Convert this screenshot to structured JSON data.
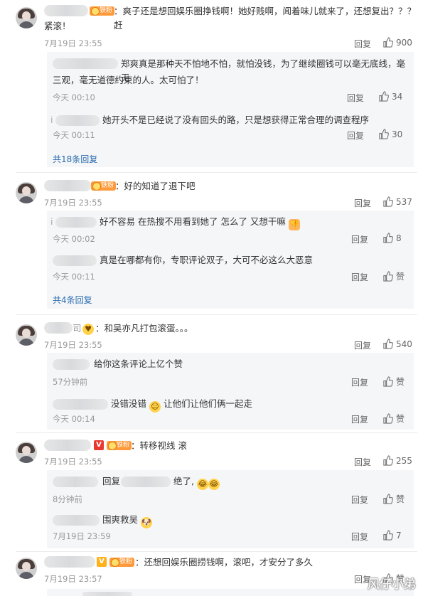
{
  "badges": {
    "fan": "铁粉",
    "vip": "V"
  },
  "comments": [
    {
      "text_line1": "：爽子还是想回娱乐圈挣钱啊！她好贱啊，闻着味儿就来了，还想复出？？？赶",
      "text_line2": "紧滚！",
      "time": "7月19日 23:55",
      "reply": "回复",
      "likes": "900",
      "subs": [
        {
          "text_line1": "郑爽真是那种天不怕地不怕，就怕没钱，为了继续圈钱可以毫无底线，毫无",
          "text_line2": "三观，毫无道德约束的人。太可怕了！",
          "time": "今天 00:10",
          "reply": "回复",
          "likes": "34"
        },
        {
          "prefix": "i",
          "text_line1": "她开头不是已经说了没有回头的路，只是想获得正常合理的调查程序",
          "time": "今天 00:11",
          "reply": "回复",
          "likes": "30"
        }
      ],
      "more": "共18条回复"
    },
    {
      "text_line1": "：好的知道了退下吧",
      "time": "7月19日 23:55",
      "reply": "回复",
      "likes": "537",
      "subs": [
        {
          "prefix": "i",
          "text_line1": "好不容易 在热搜不用看到她了 怎么了 又想干嘛",
          "time": "今天 00:02",
          "reply": "回复",
          "likes": "8"
        },
        {
          "text_line1": "真是在哪都有你，专职评论双子，大可不必这么大恶意",
          "time": "今天 00:11",
          "reply": "回复",
          "likes": "赞"
        }
      ],
      "more": "共4条回复"
    },
    {
      "name_tail": "司",
      "text_line1": "：和吴亦凡打包滚蛋。。。",
      "time": "7月19日 23:55",
      "reply": "回复",
      "likes": "540",
      "subs": [
        {
          "text_line1": "给你这条评论上亿个赞",
          "time": "57分钟前",
          "reply": "回复",
          "likes": "赞"
        },
        {
          "text_line1": "没错没错",
          "text_after": "让他们让他们俩一起走",
          "time": "今天 00:14",
          "reply": "回复",
          "likes": "赞"
        }
      ]
    },
    {
      "text_line1": "：转移视线 滚",
      "time": "7月19日 23:55",
      "reply": "回复",
      "likes": "255",
      "subs": [
        {
          "reply_prefix": "回复",
          "text_line1": "绝了,",
          "time": "8分钟前",
          "reply": "回复",
          "likes": "赞"
        },
        {
          "text_line1": "围爽救吴",
          "time": "7月19日 23:59",
          "reply": "回复",
          "likes": "7"
        }
      ]
    },
    {
      "text_line1": "：还想回娱乐圈捞钱啊，滚吧，才安分了多久",
      "time": "7月19日 23:57",
      "reply": "回复",
      "likes": "赞"
    }
  ],
  "watermark": "风仔小弟"
}
